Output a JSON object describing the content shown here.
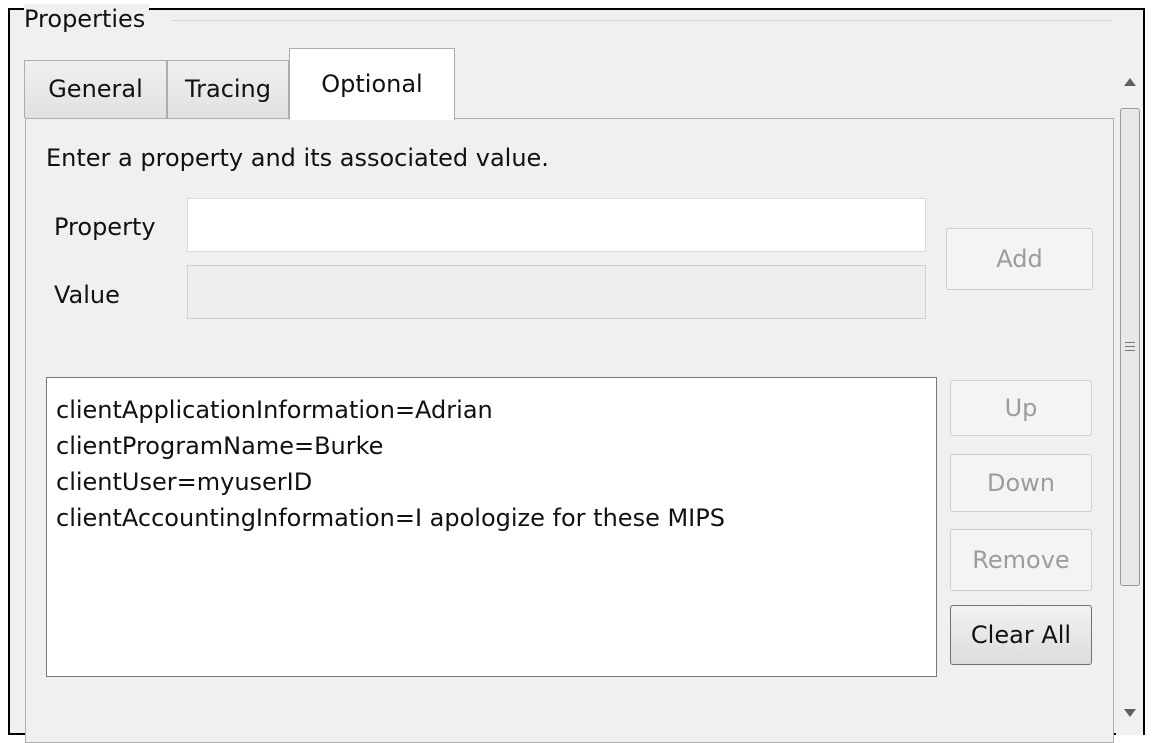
{
  "group": {
    "title": "Properties"
  },
  "tabs": [
    {
      "label": "General",
      "active": false
    },
    {
      "label": "Tracing",
      "active": false
    },
    {
      "label": "Optional",
      "active": true
    }
  ],
  "optional": {
    "instruction": "Enter a property and its associated value.",
    "property_label": "Property",
    "value_label": "Value",
    "property_value": "",
    "value_value": "",
    "add_label": "Add",
    "list_items": [
      "clientApplicationInformation=Adrian",
      "clientProgramName=Burke",
      "clientUser=myuserID",
      "clientAccountingInformation=I apologize for these MIPS"
    ],
    "up_label": "Up",
    "down_label": "Down",
    "remove_label": "Remove",
    "clear_all_label": "Clear All"
  },
  "icons": {
    "scroll_up": "triangle-up-icon",
    "scroll_down": "triangle-down-icon",
    "scroll_grip": "grip-lines-icon"
  },
  "colors": {
    "panel_background": "#f0f0f0",
    "list_background": "#ffffff",
    "disabled_text": "#9c9c9c"
  }
}
